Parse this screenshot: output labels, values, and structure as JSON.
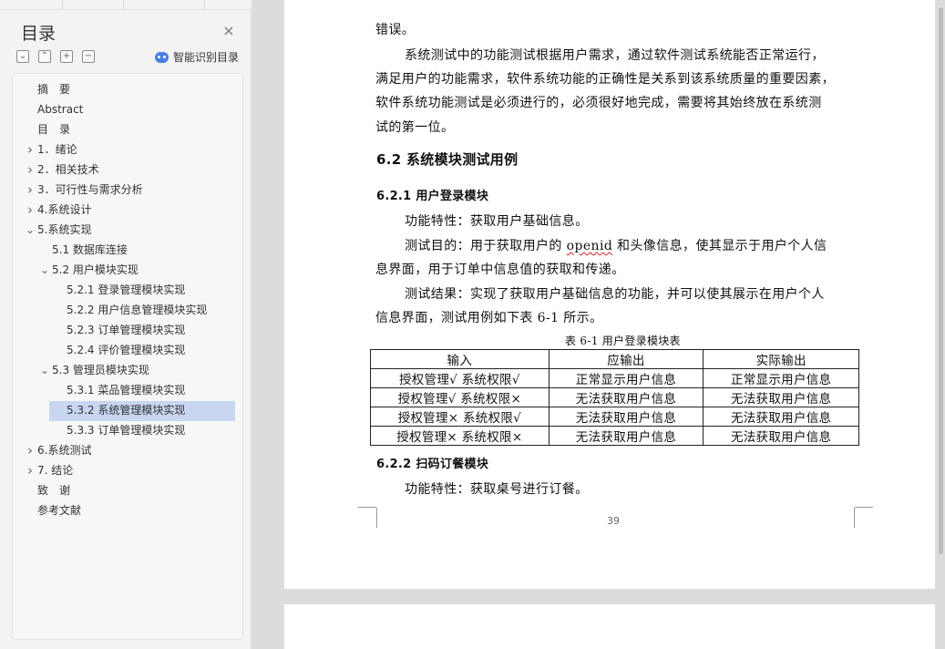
{
  "sidebar": {
    "title": "目录",
    "smart_label": "智能识别目录",
    "toc": [
      {
        "label": "摘　要",
        "level": 0,
        "expandable": false
      },
      {
        "label": "Abstract",
        "level": 0,
        "expandable": false
      },
      {
        "label": "目　录",
        "level": 0,
        "expandable": false
      },
      {
        "label": "1．绪论",
        "level": 0,
        "expandable": true,
        "expanded": false
      },
      {
        "label": "2．相关技术",
        "level": 0,
        "expandable": true,
        "expanded": false
      },
      {
        "label": "3．可行性与需求分析",
        "level": 0,
        "expandable": true,
        "expanded": false
      },
      {
        "label": "4.系统设计",
        "level": 0,
        "expandable": true,
        "expanded": false
      },
      {
        "label": "5.系统实现",
        "level": 0,
        "expandable": true,
        "expanded": true
      },
      {
        "label": "5.1 数据库连接",
        "level": 1,
        "expandable": false
      },
      {
        "label": "5.2 用户模块实现",
        "level": 1,
        "expandable": true,
        "expanded": true
      },
      {
        "label": "5.2.1  登录管理模块实现",
        "level": 2,
        "expandable": false
      },
      {
        "label": "5.2.2  用户信息管理模块实现",
        "level": 2,
        "expandable": false
      },
      {
        "label": "5.2.3  订单管理模块实现",
        "level": 2,
        "expandable": false
      },
      {
        "label": "5.2.4  评价管理模块实现",
        "level": 2,
        "expandable": false
      },
      {
        "label": "5.3  管理员模块实现",
        "level": 1,
        "expandable": true,
        "expanded": true
      },
      {
        "label": "5.3.1  菜品管理模块实现",
        "level": 2,
        "expandable": false
      },
      {
        "label": "5.3.2  系统管理模块实现",
        "level": 2,
        "expandable": false,
        "selected": true
      },
      {
        "label": "5.3.3  订单管理模块实现",
        "level": 2,
        "expandable": false
      },
      {
        "label": "6.系统测试",
        "level": 0,
        "expandable": true,
        "expanded": false
      },
      {
        "label": "7. 结论",
        "level": 0,
        "expandable": true,
        "expanded": false
      },
      {
        "label": "致　谢",
        "level": 0,
        "expandable": false
      },
      {
        "label": "参考文献",
        "level": 0,
        "expandable": false
      }
    ]
  },
  "document": {
    "line_error": "错误。",
    "para1": [
      "系统测试中的功能测试根据用户需求，通过软件测试系统能否正常运行，",
      "满足用户的功能需求，软件系统功能的正确性是关系到该系统质量的重要因素，",
      "软件系统功能测试是必须进行的，必须很好地完成，需要将其始终放在系统测",
      "试的第一位。"
    ],
    "heading_62": "6.2  系统模块测试用例",
    "heading_621": "6.2.1  用户登录模块",
    "feature1": "功能特性：获取用户基础信息。",
    "purpose1_a": "测试目的：用于获取用户的 ",
    "purpose1_openid": "openid",
    "purpose1_b": " 和头像信息，使其显示于用户个人信",
    "purpose1_line2": "息界面，用于订单中信息值的获取和传递。",
    "result1_line1": "测试结果：实现了获取用户基础信息的功能，并可以使其展示在用户个人",
    "result1_line2": "信息界面，测试用例如下表 6-1 所示。",
    "table_caption": "表 6-1  用户登录模块表",
    "table": {
      "headers": [
        "输入",
        "应输出",
        "实际输出"
      ],
      "rows": [
        [
          "授权管理√  系统权限√",
          "正常显示用户信息",
          "正常显示用户信息"
        ],
        [
          "授权管理√  系统权限×",
          "无法获取用户信息",
          "无法获取用户信息"
        ],
        [
          "授权管理×  系统权限√",
          "无法获取用户信息",
          "无法获取用户信息"
        ],
        [
          "授权管理×  系统权限×",
          "无法获取用户信息",
          "无法获取用户信息"
        ]
      ]
    },
    "heading_622": "6.2.2  扫码订餐模块",
    "feature2": "功能特性：获取桌号进行订餐。",
    "page_number": "39"
  }
}
